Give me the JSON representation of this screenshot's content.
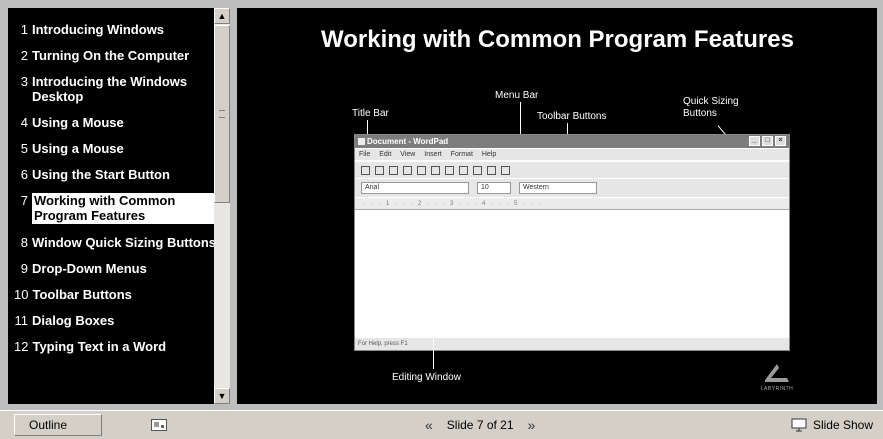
{
  "outline": {
    "items": [
      {
        "num": "1",
        "label": "Introducing Windows"
      },
      {
        "num": "2",
        "label": "Turning On the Computer"
      },
      {
        "num": "3",
        "label": "Introducing the Windows Desktop"
      },
      {
        "num": "4",
        "label": "Using a Mouse"
      },
      {
        "num": "5",
        "label": "Using a Mouse"
      },
      {
        "num": "6",
        "label": "Using the Start Button"
      },
      {
        "num": "7",
        "label": "Working with Common Program Features"
      },
      {
        "num": "8",
        "label": "Window Quick Sizing Buttons"
      },
      {
        "num": "9",
        "label": "Drop-Down Menus"
      },
      {
        "num": "10",
        "label": "Toolbar Buttons"
      },
      {
        "num": "11",
        "label": "Dialog Boxes"
      },
      {
        "num": "12",
        "label": "Typing Text in a Word"
      }
    ],
    "selected_index": 6
  },
  "slide": {
    "title": "Working with Common Program Features",
    "callouts": {
      "title_bar": "Title Bar",
      "menu_bar": "Menu Bar",
      "toolbar_buttons": "Toolbar Buttons",
      "quick_sizing": "Quick Sizing Buttons",
      "editing_window": "Editing Window"
    },
    "wordpad": {
      "title": "Document - WordPad",
      "menus": [
        "File",
        "Edit",
        "View",
        "Insert",
        "Format",
        "Help"
      ],
      "font": "Arial",
      "size": "10",
      "script": "Western",
      "status": "For Help, press F1"
    },
    "logo_text": "LABYRINTH"
  },
  "bottombar": {
    "outline_label": "Outline",
    "slide_indicator": "Slide 7 of 21",
    "slideshow_label": "Slide Show"
  },
  "icons": {
    "scroll_up": "scroll-up-icon",
    "scroll_down": "scroll-down-icon",
    "prev": "previous-slide-icon",
    "next": "next-slide-icon",
    "slideshow": "slideshow-icon",
    "thumbnails": "thumbnails-icon"
  }
}
